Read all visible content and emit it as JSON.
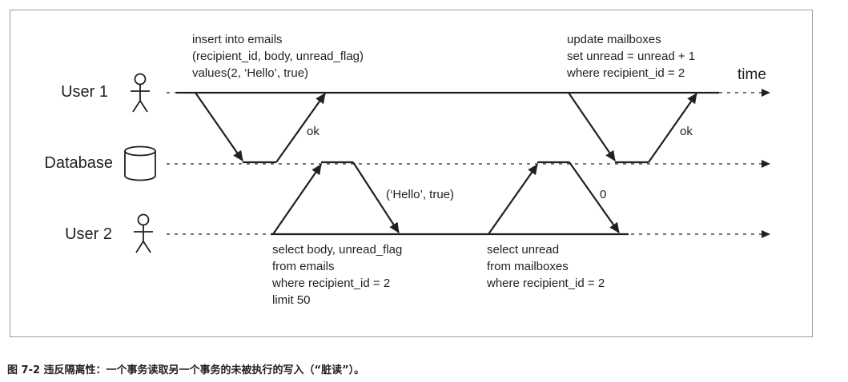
{
  "lanes": {
    "user1": "User 1",
    "database": "Database",
    "user2": "User 2",
    "time_label": "time"
  },
  "icons": {
    "user1": "stick-figure-icon",
    "database": "cylinder-icon",
    "user2": "stick-figure-icon"
  },
  "queries": {
    "insert": [
      "insert into emails",
      "(recipient_id, body, unread_flag)",
      "values(2, ‘Hello’, true)"
    ],
    "update": [
      "update mailboxes",
      "set unread = unread + 1",
      "where recipient_id = 2"
    ],
    "select_body": [
      "select body, unread_flag",
      "from emails",
      "where recipient_id = 2",
      "limit 50"
    ],
    "select_unread": [
      "select unread",
      "from mailboxes",
      "where recipient_id = 2"
    ]
  },
  "responses": {
    "insert_ok": "ok",
    "update_ok": "ok",
    "select_body_result": "(‘Hello’, true)",
    "select_unread_result": "0"
  },
  "caption": "图 7-2 违反隔离性：一个事务读取另一个事务的未被执行的写入（“脏读”）。"
}
